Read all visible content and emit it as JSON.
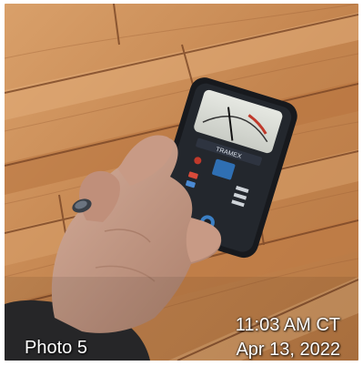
{
  "photo": {
    "label": "Photo 5",
    "time": "11:03 AM CT",
    "date": "Apr 13, 2022",
    "meter_brand": "TRAMEX"
  },
  "colors": {
    "floor_wood": "#c98d58",
    "floor_dark": "#8a5230",
    "meter_body": "#1c1f24",
    "meter_display": "#d9dcd6",
    "sleeve": "#2a2a2c",
    "skin": "#c79a86"
  }
}
